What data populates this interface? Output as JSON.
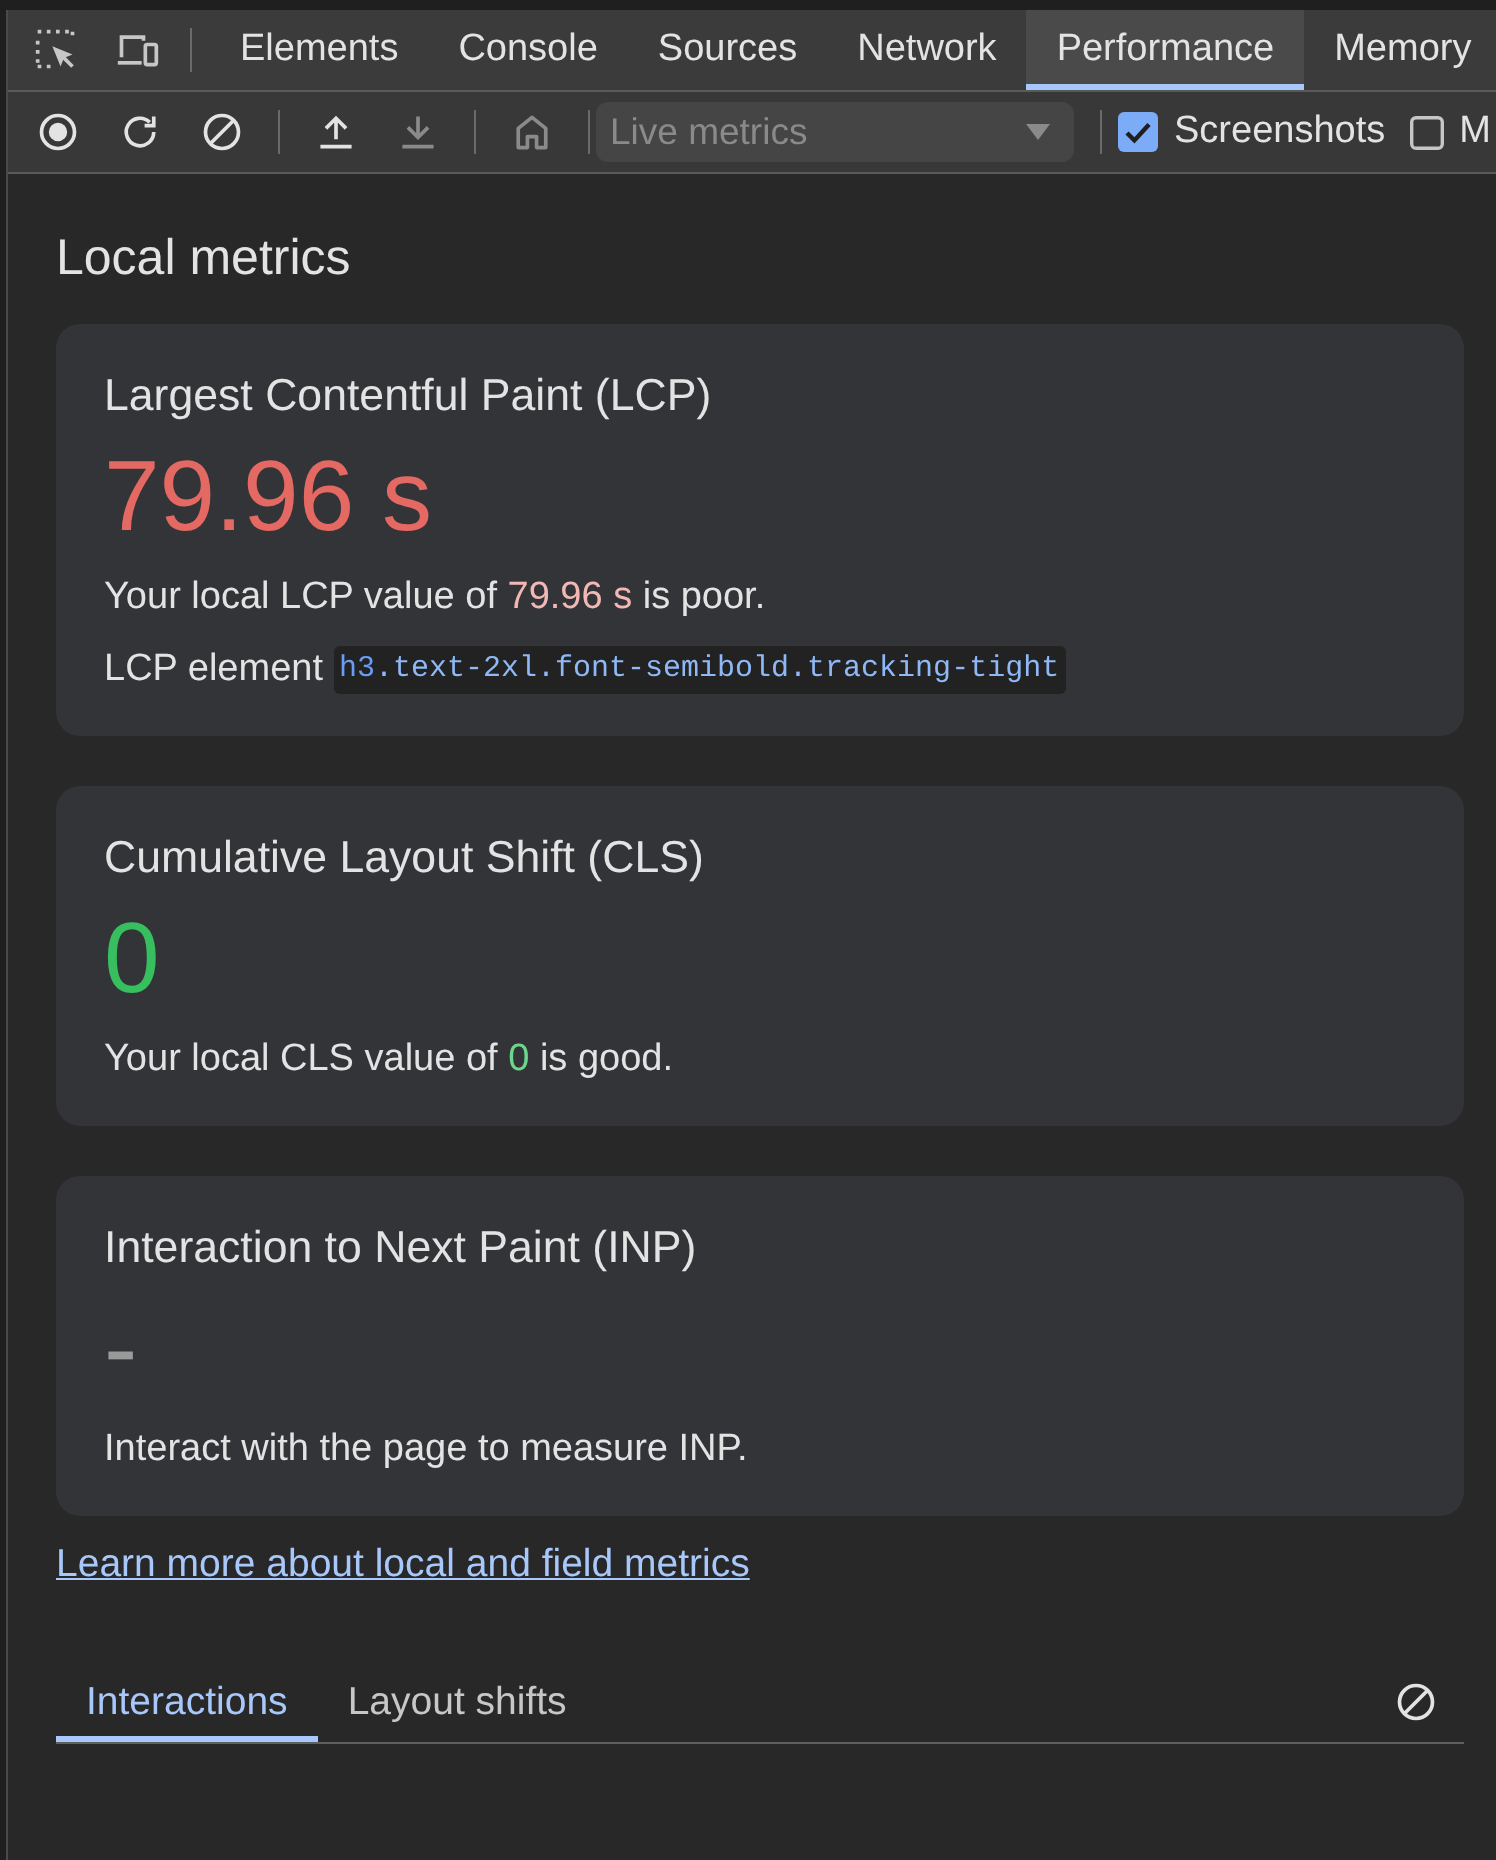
{
  "main_tabs": [
    {
      "label": "Elements",
      "selected": false
    },
    {
      "label": "Console",
      "selected": false
    },
    {
      "label": "Sources",
      "selected": false
    },
    {
      "label": "Network",
      "selected": false
    },
    {
      "label": "Performance",
      "selected": true
    },
    {
      "label": "Memory",
      "selected": false
    }
  ],
  "toolbar": {
    "button_groups": [
      [
        {
          "kind": "record",
          "disabled": false
        },
        {
          "kind": "reload",
          "disabled": false
        },
        {
          "kind": "clear",
          "disabled": false
        }
      ],
      [
        {
          "kind": "upload",
          "disabled": false
        },
        {
          "kind": "download",
          "disabled": true
        }
      ],
      [
        {
          "kind": "home",
          "disabled": true
        }
      ]
    ],
    "dropdown": {
      "value": "Live metrics",
      "disabled": true
    },
    "checkboxes": [
      {
        "label": "Screenshots",
        "checked": true
      },
      {
        "label": "M",
        "checked": false
      }
    ]
  },
  "heading": "Local metrics",
  "metrics": [
    {
      "title": "Largest Contentful Paint (LCP)",
      "value": "79.96 s",
      "color": "#e46962",
      "description": [
        {
          "text": "Your local LCP value of "
        },
        {
          "text": "79.96 s",
          "color": "#f2b8b5"
        },
        {
          "text": " is poor."
        }
      ],
      "element": {
        "label": "LCP element",
        "tag": "h3",
        "classes": ".text-2xl.font-semibold.tracking-tight"
      }
    },
    {
      "title": "Cumulative Layout Shift (CLS)",
      "value": "0",
      "color": "#37be5f",
      "description": [
        {
          "text": "Your local CLS value of "
        },
        {
          "text": "0",
          "color": "#6dd58c"
        },
        {
          "text": " is good."
        }
      ]
    },
    {
      "title": "Interaction to Next Paint (INP)",
      "value": "-",
      "color": "#9a9a9a",
      "description": [
        {
          "text": "Interact with the page to measure INP."
        }
      ]
    }
  ],
  "link": "Learn more about local and field metrics",
  "bottom_tabs": [
    {
      "label": "Interactions",
      "selected": true
    },
    {
      "label": "Layout shifts",
      "selected": false
    }
  ]
}
